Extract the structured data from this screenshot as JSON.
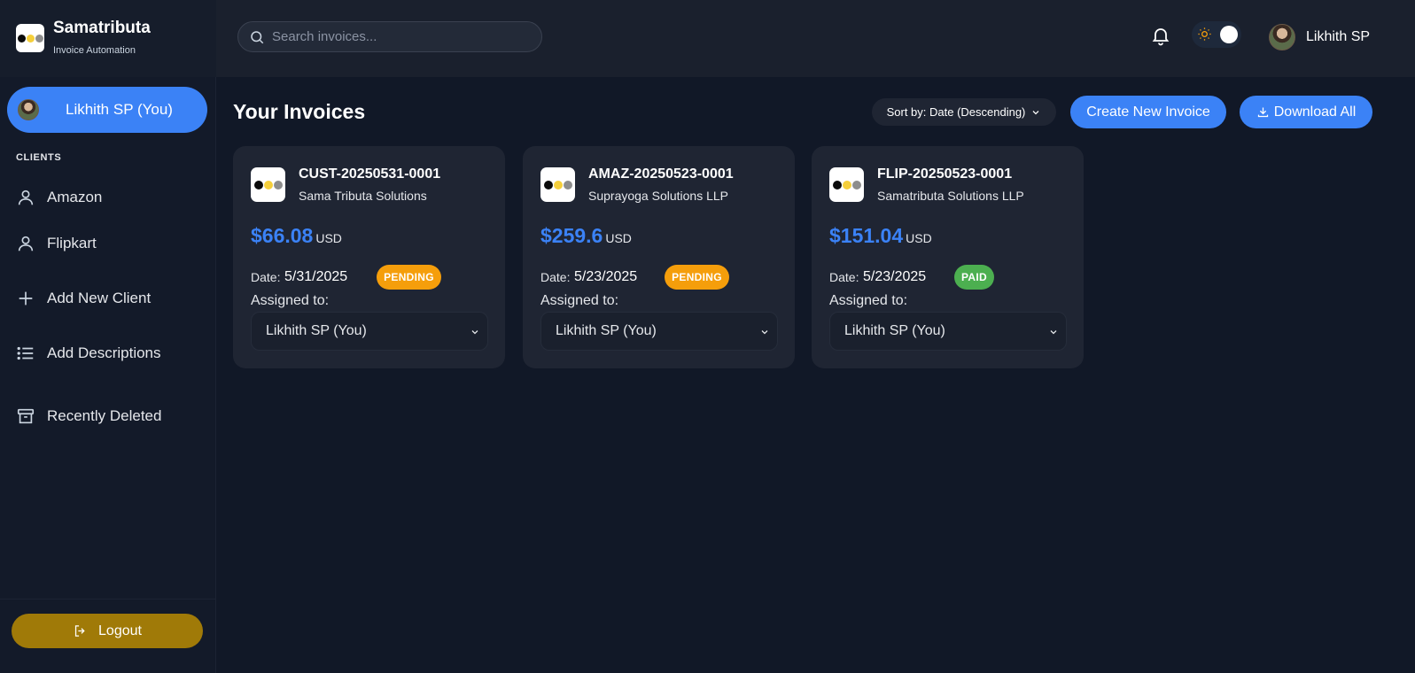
{
  "brand": {
    "name": "Samatributa",
    "subtitle": "Invoice Automation"
  },
  "sidebar": {
    "current_user": "Likhith SP (You)",
    "clients_heading": "CLIENTS",
    "clients": [
      {
        "label": "Amazon",
        "icon": "user-icon"
      },
      {
        "label": "Flipkart",
        "icon": "user-icon"
      }
    ],
    "actions": [
      {
        "label": "Add New Client",
        "icon": "plus-icon"
      },
      {
        "label": "Add Descriptions",
        "icon": "list-icon"
      },
      {
        "label": "Recently Deleted",
        "icon": "archive-icon"
      }
    ],
    "logout_label": "Logout"
  },
  "topbar": {
    "search_placeholder": "Search invoices...",
    "user_name": "Likhith SP",
    "theme": "dark"
  },
  "main": {
    "title": "Your Invoices",
    "sort_label": "Sort by: Date (Descending)",
    "create_label": "Create New Invoice",
    "download_label": "Download All"
  },
  "invoices": [
    {
      "id": "CUST-20250531-0001",
      "company": "Sama Tributa Solutions",
      "amount": "$66.08",
      "currency": "USD",
      "date_label": "Date:",
      "date": "5/31/2025",
      "status": "PENDING",
      "assigned_label": "Assigned to:",
      "assignee": "Likhith SP (You)"
    },
    {
      "id": "AMAZ-20250523-0001",
      "company": "Suprayoga Solutions LLP",
      "amount": "$259.6",
      "currency": "USD",
      "date_label": "Date:",
      "date": "5/23/2025",
      "status": "PENDING",
      "assigned_label": "Assigned to:",
      "assignee": "Likhith SP (You)"
    },
    {
      "id": "FLIP-20250523-0001",
      "company": "Samatributa Solutions LLP",
      "amount": "$151.04",
      "currency": "USD",
      "date_label": "Date:",
      "date": "5/23/2025",
      "status": "PAID",
      "assigned_label": "Assigned to:",
      "assignee": "Likhith SP (You)"
    }
  ],
  "colors": {
    "accent": "#3b82f6",
    "pending": "#f59e0b",
    "paid": "#4caf50",
    "logout": "#a07a08",
    "background": "#111827"
  }
}
